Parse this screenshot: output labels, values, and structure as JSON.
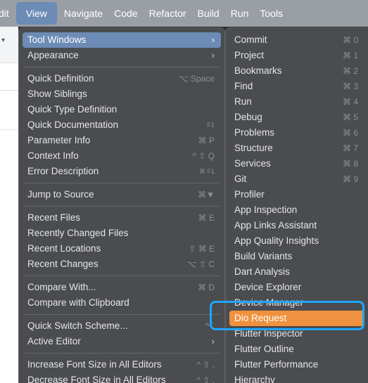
{
  "menubar": {
    "items": [
      "dit",
      "View",
      "Navigate",
      "Code",
      "Refactor",
      "Build",
      "Run",
      "Tools"
    ],
    "active": "View"
  },
  "view_menu": {
    "items": [
      {
        "label": "Tool Windows",
        "submenu": true,
        "highlighted": true
      },
      {
        "label": "Appearance",
        "submenu": true
      },
      {
        "separator": true
      },
      {
        "label": "Quick Definition",
        "shortcut": "⌥ Space"
      },
      {
        "label": "Show Siblings"
      },
      {
        "label": "Quick Type Definition"
      },
      {
        "label": "Quick Documentation",
        "shortcut": "F1"
      },
      {
        "label": "Parameter Info",
        "shortcut": "⌘ P"
      },
      {
        "label": "Context Info",
        "shortcut": "^ ⇧ Q"
      },
      {
        "label": "Error Description",
        "shortcut": "⌘ F1"
      },
      {
        "separator": true
      },
      {
        "label": "Jump to Source",
        "shortcut": "⌘▼"
      },
      {
        "separator": true
      },
      {
        "label": "Recent Files",
        "shortcut": "⌘ E"
      },
      {
        "label": "Recently Changed Files"
      },
      {
        "label": "Recent Locations",
        "shortcut": "⇧ ⌘ E"
      },
      {
        "label": "Recent Changes",
        "shortcut": "⌥ ⇧ C"
      },
      {
        "separator": true
      },
      {
        "label": "Compare With...",
        "shortcut": "⌘ D"
      },
      {
        "label": "Compare with Clipboard"
      },
      {
        "separator": true
      },
      {
        "label": "Quick Switch Scheme...",
        "shortcut": "^ `"
      },
      {
        "label": "Active Editor",
        "submenu": true
      },
      {
        "separator": true
      },
      {
        "label": "Increase Font Size in All Editors",
        "shortcut": "^ ⇧ ."
      },
      {
        "label": "Decrease Font Size in All Editors",
        "shortcut": "^ ⇧ ,"
      }
    ]
  },
  "tool_windows_menu": {
    "items": [
      {
        "label": "Commit",
        "shortcut": "⌘ 0"
      },
      {
        "label": "Project",
        "shortcut": "⌘ 1"
      },
      {
        "label": "Bookmarks",
        "shortcut": "⌘ 2"
      },
      {
        "label": "Find",
        "shortcut": "⌘ 3"
      },
      {
        "label": "Run",
        "shortcut": "⌘ 4"
      },
      {
        "label": "Debug",
        "shortcut": "⌘ 5"
      },
      {
        "label": "Problems",
        "shortcut": "⌘ 6"
      },
      {
        "label": "Structure",
        "shortcut": "⌘ 7"
      },
      {
        "label": "Services",
        "shortcut": "⌘ 8"
      },
      {
        "label": "Git",
        "shortcut": "⌘ 9"
      },
      {
        "label": "Profiler"
      },
      {
        "label": "App Inspection"
      },
      {
        "label": "App Links Assistant"
      },
      {
        "label": "App Quality Insights"
      },
      {
        "label": "Build Variants"
      },
      {
        "label": "Dart Analysis"
      },
      {
        "label": "Device Explorer"
      },
      {
        "label": "Device Manager"
      },
      {
        "label": "Dio Request",
        "selected": true
      },
      {
        "label": "Flutter Inspector"
      },
      {
        "label": "Flutter Outline"
      },
      {
        "label": "Flutter Performance"
      },
      {
        "label": "Hierarchy"
      }
    ]
  },
  "colors": {
    "menubar_bg": "#9a9fa5",
    "menu_bg": "#4a4c4f",
    "highlight": "#6c8bb5",
    "selected": "#f0913f",
    "focus_ring": "#1ea7ff"
  }
}
